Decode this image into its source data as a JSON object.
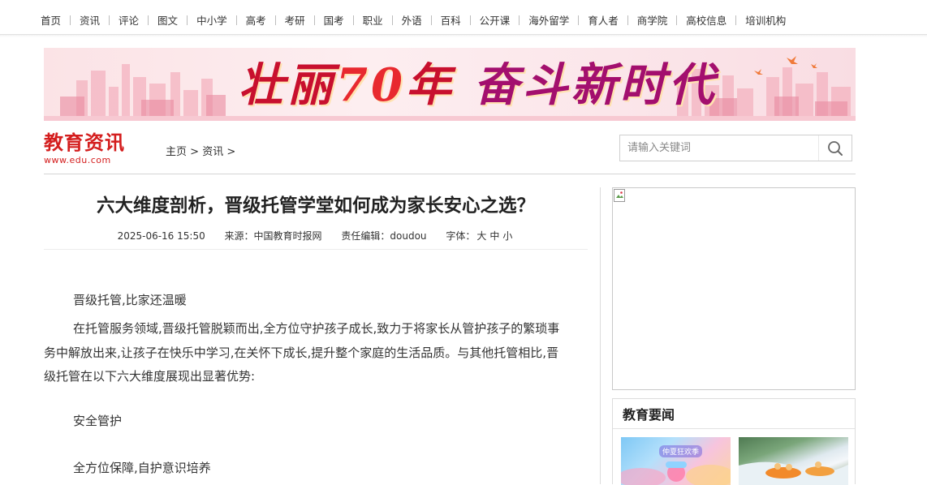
{
  "topnav": {
    "items": [
      "首页",
      "资讯",
      "评论",
      "图文",
      "中小学",
      "高考",
      "考研",
      "国考",
      "职业",
      "外语",
      "百科",
      "公开课",
      "海外留学",
      "育人者",
      "商学院",
      "高校信息",
      "培训机构"
    ]
  },
  "banner": {
    "part1": "壮丽",
    "num": "70",
    "part1b": "年",
    "part2": "奋斗新时代"
  },
  "logo": {
    "name": "教育资讯",
    "url": "www.edu.com"
  },
  "breadcrumb": {
    "home": "主页",
    "sep": ">",
    "section": "资讯"
  },
  "search": {
    "placeholder": "请输入关键词"
  },
  "article": {
    "title": "六大维度剖析，晋级托管学堂如何成为家长安心之选？",
    "date": "2025-06-16 15:50",
    "source": "来源：中国教育时报网",
    "editor": "责任编辑：doudou",
    "font_label": "字体：",
    "font_sizes": [
      "大",
      "中",
      "小"
    ],
    "paragraphs": [
      "晋级托管,比家还温暖",
      "在托管服务领域,晋级托管脱颖而出,全方位守护孩子成长,致力于将家长从管护孩子的繁琐事务中解放出来,让孩子在快乐中学习,在关怀下成长,提升整个家庭的生活品质。与其他托管相比,晋级托管在以下六大维度展现出显著优势:",
      "安全管护",
      "全方位保障,自护意识培养"
    ]
  },
  "sidebar": {
    "news_title": "教育要闻",
    "thumb1_tag": "仲夏狂欢季"
  },
  "colors": {
    "brand_red": "#d41e1e",
    "banner_red": "#c8102e"
  }
}
